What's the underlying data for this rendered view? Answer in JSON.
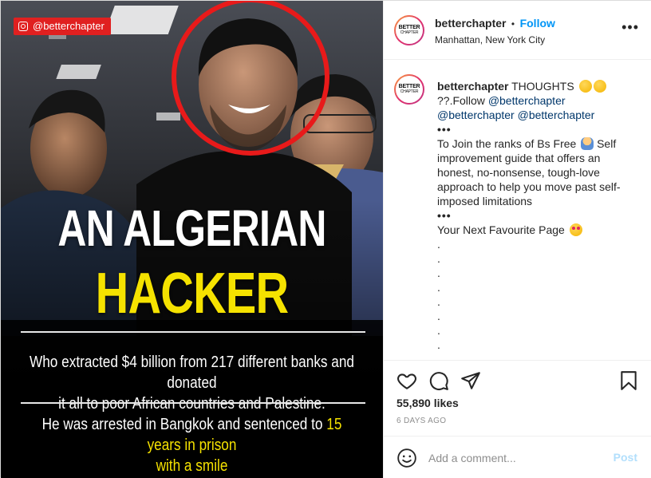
{
  "media": {
    "watermark": "@betterchapter",
    "headline_line1": "AN ALGERIAN",
    "headline_line2": "HACKER",
    "body_line1": "Who extracted $4 billion from 217 different banks and donated",
    "body_line2": "it all to poor African countries and Palestine.",
    "body_line3_prefix": "He was arrested in Bangkok and sentenced to ",
    "body_line3_highlight": "15 years in prison",
    "body_line4": "with a smile"
  },
  "header": {
    "username": "betterchapter",
    "separator": "•",
    "follow_label": "Follow",
    "location": "Manhattan, New York City",
    "more_label": "•••",
    "avatar_text": "BETTER",
    "avatar_subtext": "CHAPTER"
  },
  "caption": {
    "username": "betterchapter",
    "line1": "THOUGHTS",
    "line2_prefix": "??.Follow ",
    "mention": "@betterchapter",
    "dots": "•••",
    "paragraph": "To Join the ranks of Bs Free",
    "paragraph_rest": "Self improvement guide that offers an honest, no-nonsense, tough-love approach to help you move past self-imposed limitations",
    "tagline": "Your Next Favourite Page",
    "trailing_dots": [
      ".",
      ".",
      ".",
      ".",
      ".",
      ".",
      ".",
      "."
    ]
  },
  "actions": {
    "likes": "55,890 likes",
    "age": "6 DAYS AGO"
  },
  "comment": {
    "placeholder": "Add a comment...",
    "post_label": "Post"
  },
  "colors": {
    "accent": "#0095f6",
    "headline_yellow": "#f5e200",
    "watermark_red": "#e02020",
    "circle_red": "#e81a1a",
    "post_disabled": "#b2dffc"
  },
  "icons": [
    "instagram-icon",
    "heart-icon",
    "comment-icon",
    "share-icon",
    "bookmark-icon",
    "emoji-icon",
    "more-icon"
  ]
}
